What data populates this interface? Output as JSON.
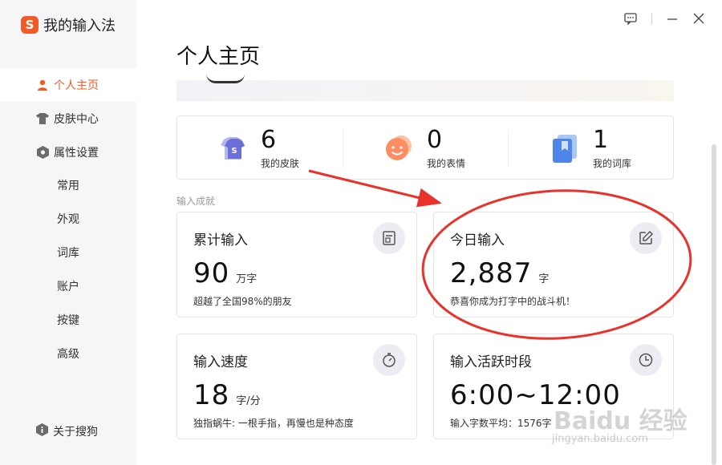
{
  "app": {
    "logo_letter": "S",
    "title": "我的输入法"
  },
  "sidebar": {
    "items": [
      {
        "label": "个人主页",
        "icon": "user-icon",
        "active": true
      },
      {
        "label": "皮肤中心",
        "icon": "shirt-icon",
        "active": false
      },
      {
        "label": "属性设置",
        "icon": "hexagon-settings-icon",
        "active": false
      }
    ],
    "sub_items": [
      "常用",
      "外观",
      "词库",
      "账户",
      "按键",
      "高级"
    ],
    "about": {
      "label": "关于搜狗",
      "icon": "info-icon"
    }
  },
  "window_controls": [
    "feedback-icon",
    "minimize-icon",
    "close-icon"
  ],
  "page": {
    "title": "个人主页"
  },
  "stats": [
    {
      "value": "6",
      "label": "我的皮肤",
      "icon": "skin-icon"
    },
    {
      "value": "0",
      "label": "我的表情",
      "icon": "emoji-icon"
    },
    {
      "value": "1",
      "label": "我的词库",
      "icon": "dictionary-icon"
    }
  ],
  "achievements": {
    "section_label": "输入成就",
    "cards": [
      {
        "title": "累计输入",
        "value": "90",
        "unit": "万字",
        "desc": "超越了全国98%的朋友",
        "icon": "document-icon"
      },
      {
        "title": "今日输入",
        "value": "2,887",
        "unit": "字",
        "desc": "恭喜你成为打字中的战斗机！",
        "icon": "edit-icon"
      },
      {
        "title": "输入速度",
        "value": "18",
        "unit": "字/分",
        "desc": "独指蜗牛: 一根手指，再慢也是种态度",
        "icon": "stopwatch-icon"
      },
      {
        "title": "输入活跃时段",
        "value": "6:00~12:00",
        "unit": "",
        "desc": "输入字数平均：1576字",
        "icon": "clock-icon"
      }
    ]
  },
  "watermark": {
    "brand": "Baidu 经验",
    "url": "jingyan.baidu.com"
  },
  "colors": {
    "accent": "#f05a24",
    "annotation": "#e8322a",
    "icon_bg": "#ececf3"
  }
}
